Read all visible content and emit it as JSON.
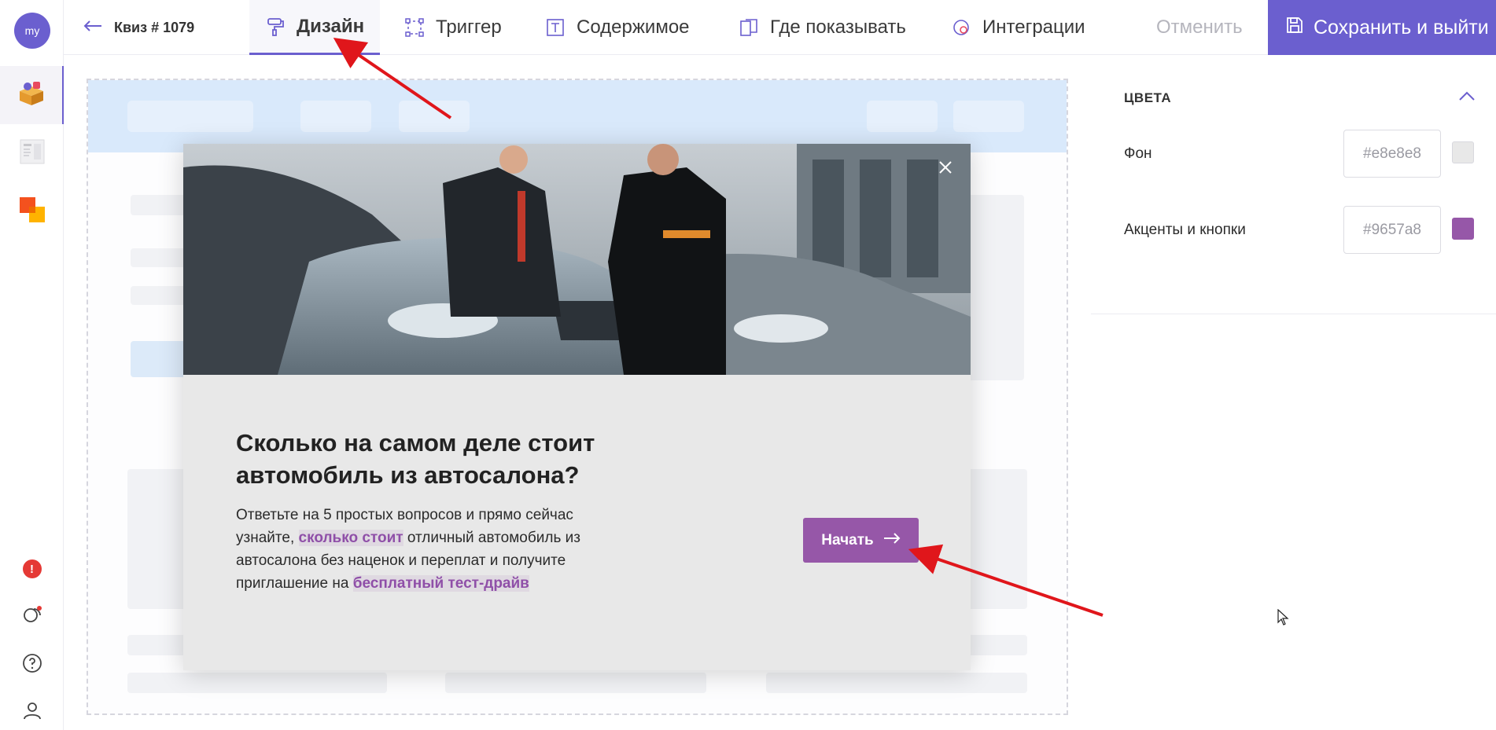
{
  "user": {
    "initials": "my"
  },
  "nav": {
    "back_label": "Квиз # 1079",
    "tabs": [
      {
        "label": "Дизайн",
        "icon": "paint-roller-icon",
        "active": true
      },
      {
        "label": "Триггер",
        "icon": "selection-frame-icon"
      },
      {
        "label": "Содержимое",
        "icon": "text-box-icon"
      },
      {
        "label": "Где показывать",
        "icon": "pages-icon"
      },
      {
        "label": "Интеграции",
        "icon": "integrations-icon"
      }
    ],
    "cancel_label": "Отменить",
    "save_label": "Сохранить и выйти"
  },
  "sidebar": {
    "items": [
      {
        "icon": "design-box-icon",
        "active": true
      },
      {
        "icon": "form-page-icon"
      },
      {
        "icon": "color-squares-icon"
      }
    ],
    "bottom": [
      {
        "icon": "alert-icon",
        "text": "!"
      },
      {
        "icon": "chat-icon"
      },
      {
        "icon": "help-icon"
      },
      {
        "icon": "user-icon"
      }
    ]
  },
  "popup": {
    "title": "Сколько на самом деле стоит автомобиль из автосалона?",
    "desc_1": "Ответьте на 5 простых вопросов и прямо сейчас узнайте,",
    "desc_hl_1": "сколько стоит",
    "desc_2": "отличный автомобиль из автосалона без наценок и переплат и получите приглашение на",
    "desc_hl_2": "бесплатный тест-драйв",
    "start_label": "Начать"
  },
  "panel": {
    "section_title": "ЦВЕТА",
    "rows": [
      {
        "label": "Фон",
        "hex": "#e8e8e8",
        "color": "#e8e8e8"
      },
      {
        "label": "Акценты и кнопки",
        "hex": "#9657a8",
        "color": "#9657a8"
      }
    ]
  },
  "colors": {
    "brand": "#6b5fcf",
    "accent": "#9657a8",
    "annotation_arrow": "#e0161b"
  }
}
